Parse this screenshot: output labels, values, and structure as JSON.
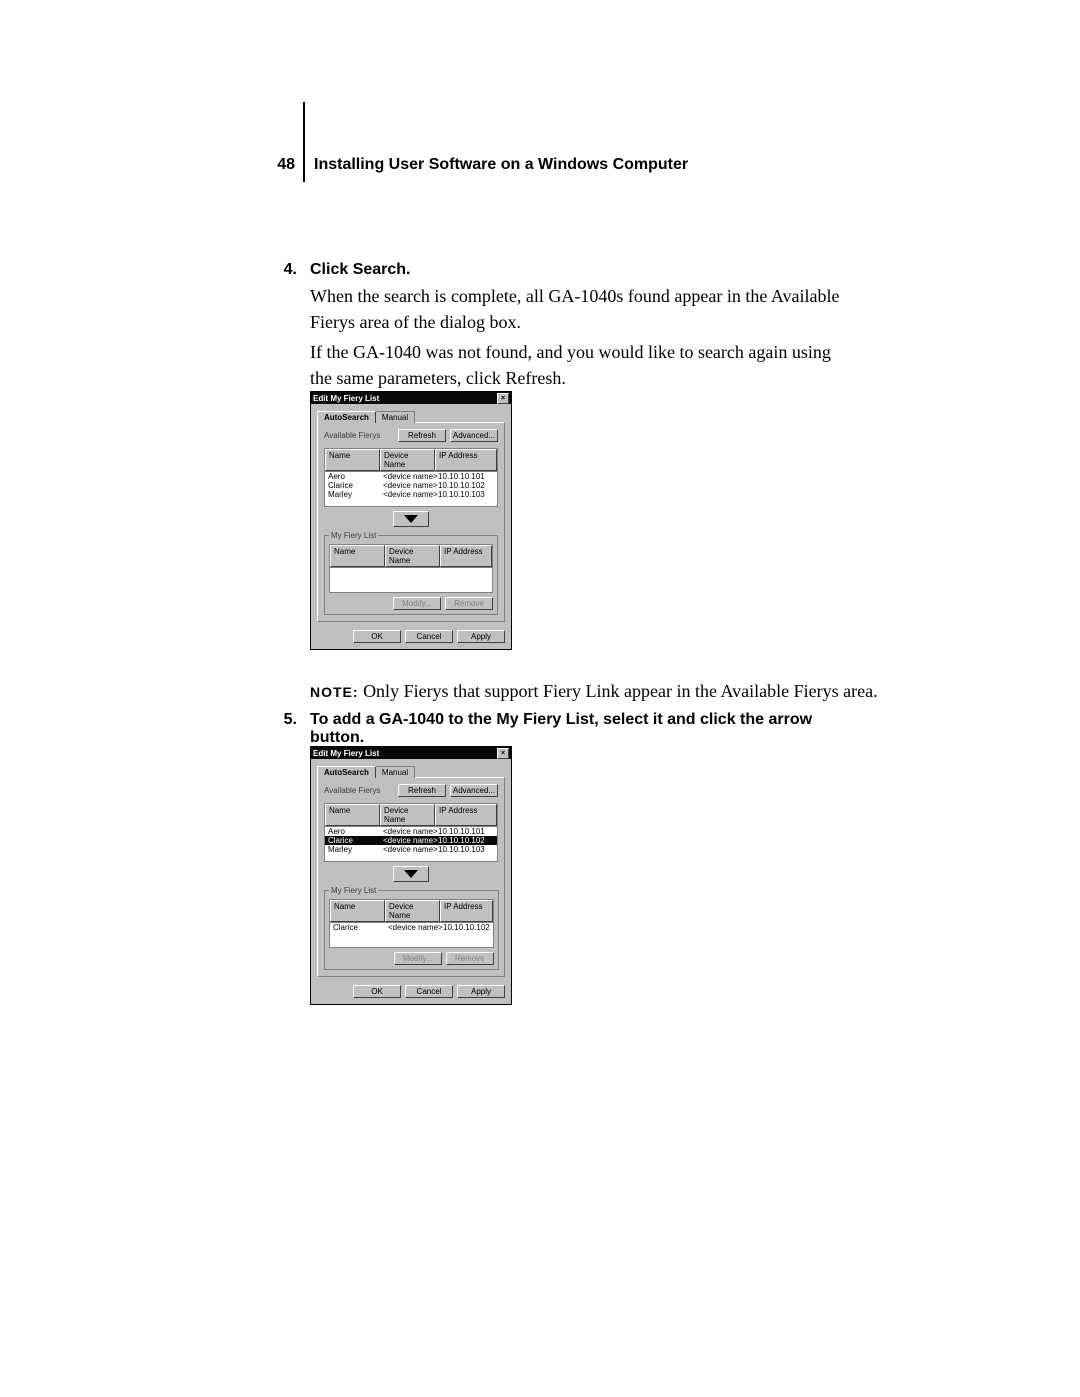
{
  "header": {
    "page_number": "48",
    "title": "Installing User Software on a Windows Computer"
  },
  "step4": {
    "num": "4.",
    "head": "Click Search.",
    "para1": "When the search is complete, all GA-1040s found appear in the Available Fierys area of the dialog box.",
    "para2": "If the GA-1040 was not found, and you would like to search again using the same parameters, click Refresh."
  },
  "note": {
    "label": "NOTE:",
    "text": " Only Fierys that support Fiery Link appear in the Available Fierys area."
  },
  "step5": {
    "num": "5.",
    "head": "To add a GA-1040 to the My Fiery List, select it and click the arrow button."
  },
  "tabs": {
    "auto": "AutoSearch",
    "manual": "Manual"
  },
  "labels": {
    "available": "Available Fierys",
    "myfiery": "My Fiery List",
    "name": "Name",
    "device": "Device Name",
    "ip": "IP Address"
  },
  "buttons": {
    "refresh": "Refresh",
    "advanced": "Advanced...",
    "modify": "Modify...",
    "remove": "Remove",
    "ok": "OK",
    "cancel": "Cancel",
    "apply": "Apply"
  },
  "rows": [
    {
      "name": "Aero",
      "device": "<device name>",
      "ip": "10.10.10.101"
    },
    {
      "name": "Clarice",
      "device": "<device name>",
      "ip": "10.10.10.102"
    },
    {
      "name": "Marley",
      "device": "<device name>",
      "ip": "10.10.10.103"
    }
  ],
  "dialog1": {
    "title": "Edit My Fiery List",
    "selected_index": -1,
    "mylist": []
  },
  "dialog2": {
    "title": "Edit My Fiery List",
    "selected_index": 1,
    "mylist": [
      {
        "name": "Clarice",
        "device": "<device name>",
        "ip": "10.10.10.102"
      }
    ]
  }
}
